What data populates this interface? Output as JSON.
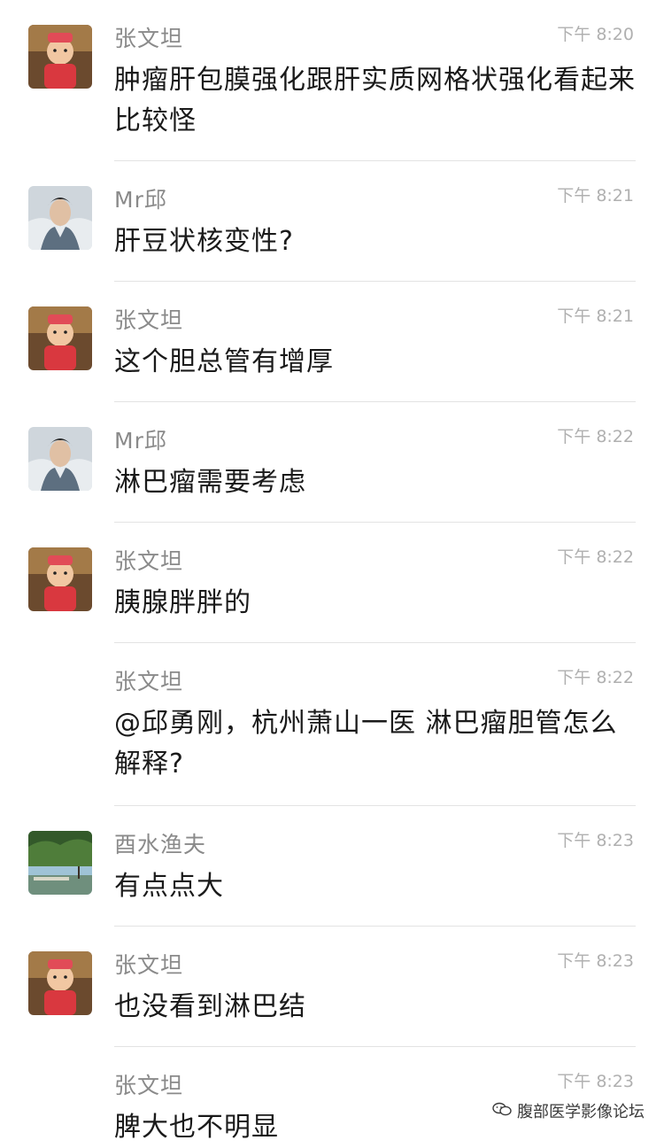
{
  "messages": [
    {
      "sender": "张文坦",
      "time": "下午 8:20",
      "text": "肿瘤肝包膜强化跟肝实质网格状强化看起来比较怪",
      "avatar": "cartoon-child-avatar"
    },
    {
      "sender": "Mr邱",
      "time": "下午 8:21",
      "text": "肝豆状核变性?",
      "avatar": "man-portrait-avatar"
    },
    {
      "sender": "张文坦",
      "time": "下午 8:21",
      "text": "这个胆总管有增厚",
      "avatar": "cartoon-child-avatar"
    },
    {
      "sender": "Mr邱",
      "time": "下午 8:22",
      "text": "淋巴瘤需要考虑",
      "avatar": "man-portrait-avatar"
    },
    {
      "sender": "张文坦",
      "time": "下午 8:22",
      "text": "胰腺胖胖的",
      "avatar": "cartoon-child-avatar"
    },
    {
      "sender": "张文坦",
      "time": "下午 8:22",
      "text": "@邱勇刚，杭州萧山一医 淋巴瘤胆管怎么解释?",
      "avatar": ""
    },
    {
      "sender": "酉水渔夫",
      "time": "下午 8:23",
      "text": "有点点大",
      "avatar": "landscape-avatar"
    },
    {
      "sender": "张文坦",
      "time": "下午 8:23",
      "text": "也没看到淋巴结",
      "avatar": "cartoon-child-avatar"
    },
    {
      "sender": "张文坦",
      "time": "下午 8:23",
      "text": "脾大也不明显",
      "avatar": ""
    }
  ],
  "watermark": {
    "text": "腹部医学影像论坛",
    "icon": "wechat-official-account-icon"
  }
}
